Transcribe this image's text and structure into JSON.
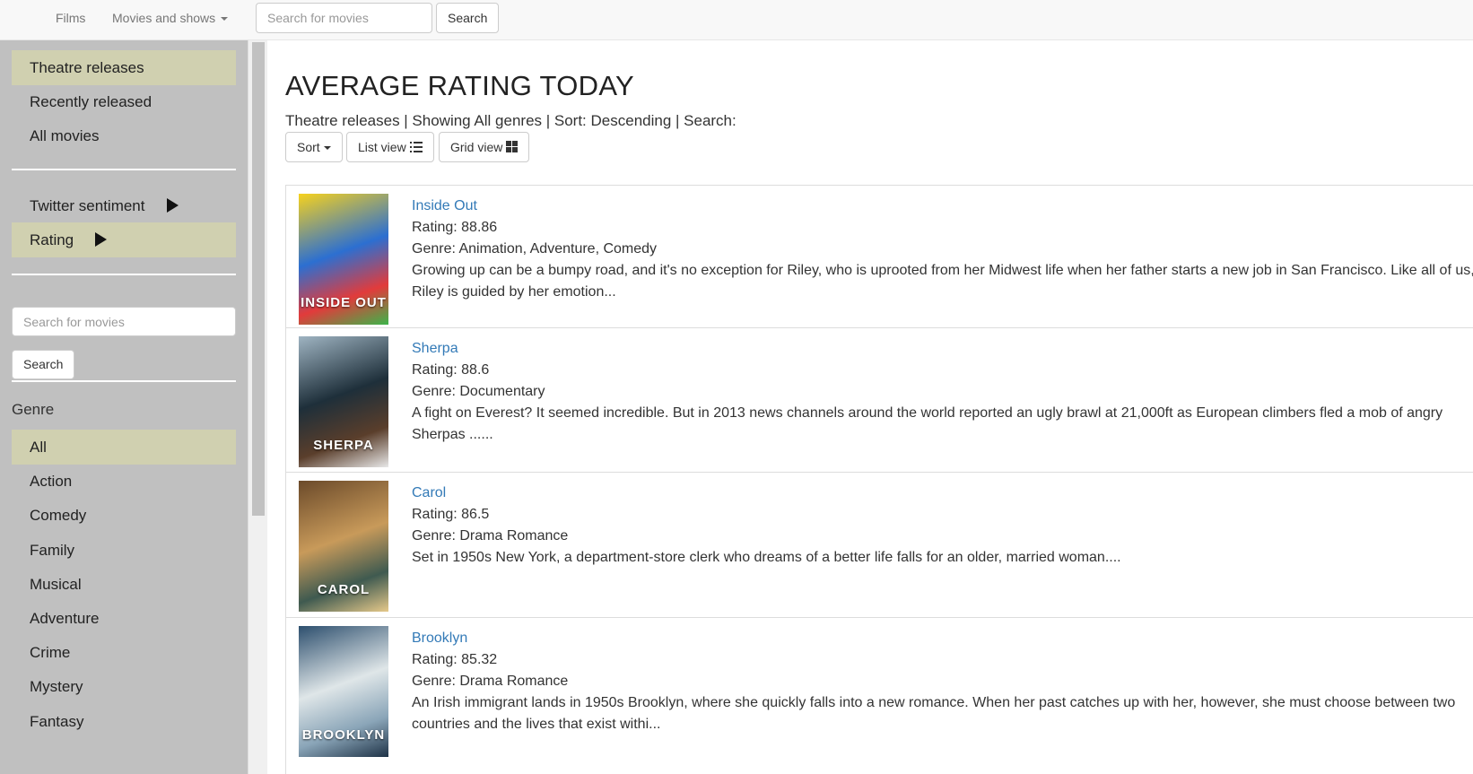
{
  "navbar": {
    "films_label": "Films",
    "movies_menu_label": "Movies and shows",
    "search_placeholder": "Search for movies",
    "search_button": "Search"
  },
  "sidebar": {
    "sections": [
      {
        "label": "Theatre releases",
        "active": true
      },
      {
        "label": "Recently released",
        "active": false
      },
      {
        "label": "All movies",
        "active": false
      }
    ],
    "rankings": [
      {
        "label": "Twitter sentiment",
        "active": false,
        "icon": "play-triangle-icon"
      },
      {
        "label": "Rating",
        "active": true,
        "icon": "play-triangle-icon"
      }
    ],
    "search_placeholder": "Search for movies",
    "search_button": "Search",
    "genre_heading": "Genre",
    "genres": [
      {
        "label": "All",
        "active": true
      },
      {
        "label": "Action",
        "active": false
      },
      {
        "label": "Comedy",
        "active": false
      },
      {
        "label": "Family",
        "active": false
      },
      {
        "label": "Musical",
        "active": false
      },
      {
        "label": "Adventure",
        "active": false
      },
      {
        "label": "Crime",
        "active": false
      },
      {
        "label": "Mystery",
        "active": false
      },
      {
        "label": "Fantasy",
        "active": false
      }
    ],
    "active_color": "#d0d0b0",
    "background_color": "#c0c0c0"
  },
  "main": {
    "title": "AVERAGE RATING TODAY",
    "filter_summary": "Theatre releases | Showing All genres | Sort: Descending | Search:",
    "toolbar": {
      "sort_label": "Sort",
      "list_view_label": "List view",
      "grid_view_label": "Grid view"
    },
    "movies": [
      {
        "title": "Inside Out",
        "rating": "Rating: 88.86",
        "genre": "Genre: Animation, Adventure, Comedy",
        "description": "Growing up can be a bumpy road, and it's no exception for Riley, who is uprooted from her Midwest life when her father starts a new job in San Francisco. Like all of us, Riley is guided by her emotion...",
        "poster_text": "INSIDE OUT",
        "poster_colors": [
          "#2c6fd1",
          "#f7d21d",
          "#e23b3b",
          "#3cb54a"
        ]
      },
      {
        "title": "Sherpa",
        "rating": "Rating: 88.6",
        "genre": "Genre: Documentary",
        "description": "A fight on Everest? It seemed incredible. But in 2013 news channels around the world reported an ugly brawl at 21,000ft as European climbers fled a mob of angry Sherpas ......",
        "poster_text": "SHERPA",
        "poster_colors": [
          "#1e2f3a",
          "#9fb4c2",
          "#5a3e2b",
          "#e8e8e8"
        ]
      },
      {
        "title": "Carol",
        "rating": "Rating: 86.5",
        "genre": "Genre: Drama Romance",
        "description": "Set in 1950s New York, a department-store clerk who dreams of a better life falls for an older, married woman....",
        "poster_text": "CAROL",
        "poster_colors": [
          "#c89a5a",
          "#6b4a2a",
          "#3f5a50",
          "#e6c98a"
        ]
      },
      {
        "title": "Brooklyn",
        "rating": "Rating: 85.32",
        "genre": "Genre: Drama Romance",
        "description": "An Irish immigrant lands in 1950s Brooklyn, where she quickly falls into a new romance. When her past catches up with her, however, she must choose between two countries and the lives that exist withi...",
        "poster_text": "BROOKLYN",
        "poster_colors": [
          "#dfe6e8",
          "#2d4f6e",
          "#8aa5b8",
          "#1f3347"
        ]
      }
    ],
    "link_color": "#337ab7"
  }
}
